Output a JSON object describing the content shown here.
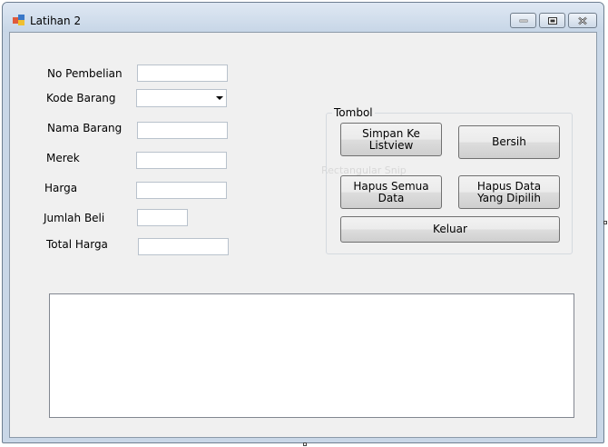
{
  "window": {
    "title": "Latihan 2",
    "icons": {
      "app": "form-app-icon",
      "minimize": "minimize-icon",
      "maximize": "maximize-icon",
      "close": "close-icon"
    }
  },
  "form": {
    "labels": {
      "no_pembelian": "No Pembelian",
      "kode_barang": "Kode Barang",
      "nama_barang": "Nama Barang",
      "merek": "Merek",
      "harga": "Harga",
      "jumlah_beli": "Jumlah Beli",
      "total_harga": "Total Harga"
    },
    "values": {
      "no_pembelian": "",
      "kode_barang": "",
      "nama_barang": "",
      "merek": "",
      "harga": "",
      "jumlah_beli": "",
      "total_harga": ""
    }
  },
  "tombol": {
    "title": "Tombol",
    "simpan": "Simpan Ke Listview",
    "bersih": "Bersih",
    "hapus_semua": "Hapus Semua Data",
    "hapus_dipilih": "Hapus Data Yang Dipilih",
    "keluar": "Keluar"
  },
  "overlay": {
    "ghost_text": "Rectangular Snip"
  },
  "listview": {
    "items": []
  }
}
